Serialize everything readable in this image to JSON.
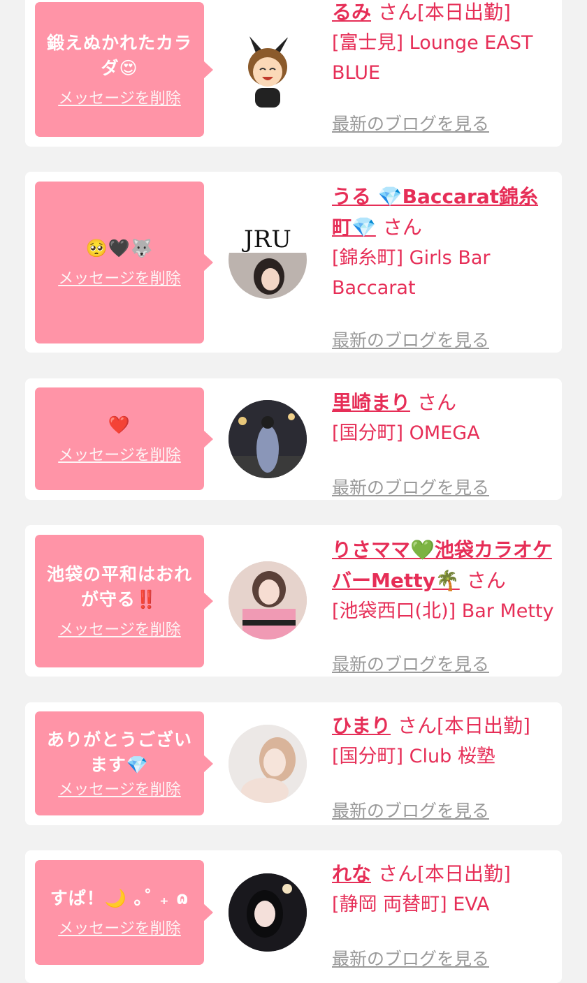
{
  "delete_label": "メッセージを削除",
  "blog_label": "最新のブログを見る",
  "san_label": "さん",
  "colors": {
    "bubble": "#ff94a7",
    "accent": "#e62e57",
    "link_gray": "#9a9a9a",
    "background": "#f2f2f2"
  },
  "cards": [
    {
      "message": "鍛えぬかれたカラダ😍",
      "name": "るみ",
      "status": "[本日出勤]",
      "shop": "[富士見] Lounge EAST BLUE"
    },
    {
      "message": "🥺🖤🐺",
      "name": "うる 💎Baccarat錦糸町💎",
      "status": "",
      "shop": "[錦糸町] Girls Bar Baccarat"
    },
    {
      "message": "❤️",
      "name": "里崎まり",
      "status": "",
      "shop": "[国分町] OMEGA"
    },
    {
      "message": "池袋の平和はおれが守る‼️",
      "name": "りさママ💚池袋カラオケバーMetty🌴",
      "status": "",
      "shop": "[池袋西口(北)] Bar Metty"
    },
    {
      "message": "ありがとうございます💎",
      "name": "ひまり",
      "status": "[本日出勤]",
      "shop": "[国分町] Club 桜塾"
    },
    {
      "message": "すぱ！🌙 ｡˚ ₊ ɷ",
      "name": "れな",
      "status": "[本日出勤]",
      "shop": "[静岡 両替町] EVA"
    }
  ]
}
